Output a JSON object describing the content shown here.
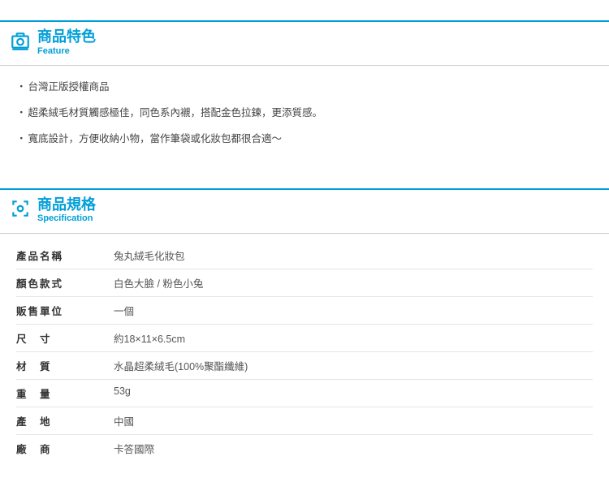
{
  "sections": {
    "feature": {
      "title_zh": "商品特色",
      "title_en": "Feature",
      "items": [
        "台灣正版授權商品",
        "超柔絨毛材質觸感極佳，同色系內襯，搭配金色拉鍊，更添質感。",
        "寬底設計，方便收納小物，當作筆袋或化妝包都很合適～"
      ]
    },
    "spec": {
      "title_zh": "商品規格",
      "title_en": "Specification",
      "rows": [
        {
          "label": "產品名稱",
          "value": "兔丸絨毛化妝包"
        },
        {
          "label": "顏色款式",
          "value": "白色大臉 / 粉色小兔"
        },
        {
          "label": "販售單位",
          "value": "一個"
        },
        {
          "label": "尺　寸",
          "value": "約18×11×6.5cm"
        },
        {
          "label": "材　質",
          "value": "水晶超柔絨毛(100%聚酯纖維)"
        },
        {
          "label": "重　量",
          "value": "53g"
        },
        {
          "label": "產　地",
          "value": "中國"
        },
        {
          "label": "廠　商",
          "value": "卡答國際"
        }
      ]
    }
  }
}
